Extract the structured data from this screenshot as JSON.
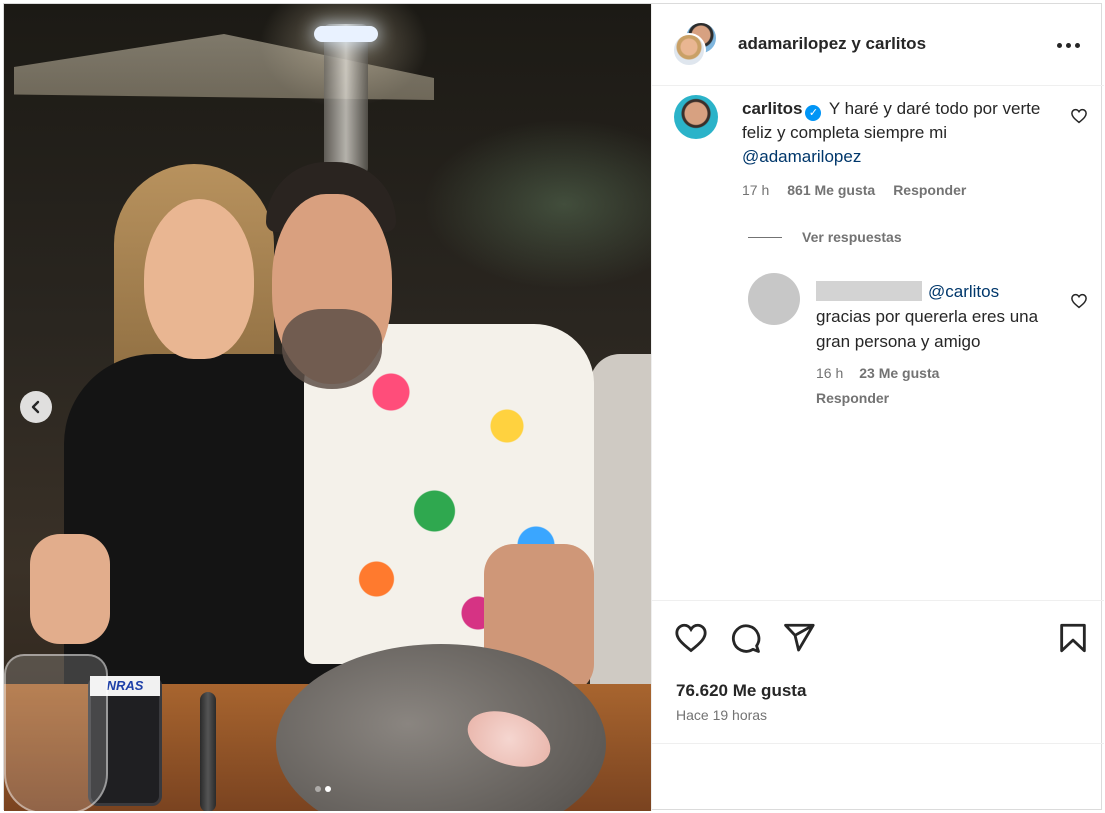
{
  "photo": {
    "phone_sticker_text": "NRAS",
    "carousel_dots": 2,
    "carousel_active_index": 1
  },
  "header": {
    "title": "adamarilopez y carlitos"
  },
  "comment": {
    "username": "carlitos",
    "verified": true,
    "text": "Y haré y daré todo por verte feliz y completa siempre mi",
    "mention": "@adamarilopez",
    "time": "17 h",
    "likes": "861 Me gusta",
    "reply_label": "Responder"
  },
  "view_replies_label": "Ver respuestas",
  "reply": {
    "mention": "@carlitos",
    "text": "gracias por quererla eres una gran persona y amigo",
    "time": "16 h",
    "likes": "23 Me gusta",
    "reply_label": "Responder"
  },
  "footer": {
    "likes": "76.620 Me gusta",
    "time": "Hace 19 horas"
  },
  "icons": {
    "like": "heart-icon",
    "comment": "comment-icon",
    "share": "send-icon",
    "save": "bookmark-icon",
    "more": "more-icon",
    "prev": "chevron-left-icon"
  },
  "colors": {
    "text": "#262626",
    "secondary": "#737373",
    "mention": "#00376b",
    "verified": "#0095f6",
    "border": "#dbdbdb"
  }
}
